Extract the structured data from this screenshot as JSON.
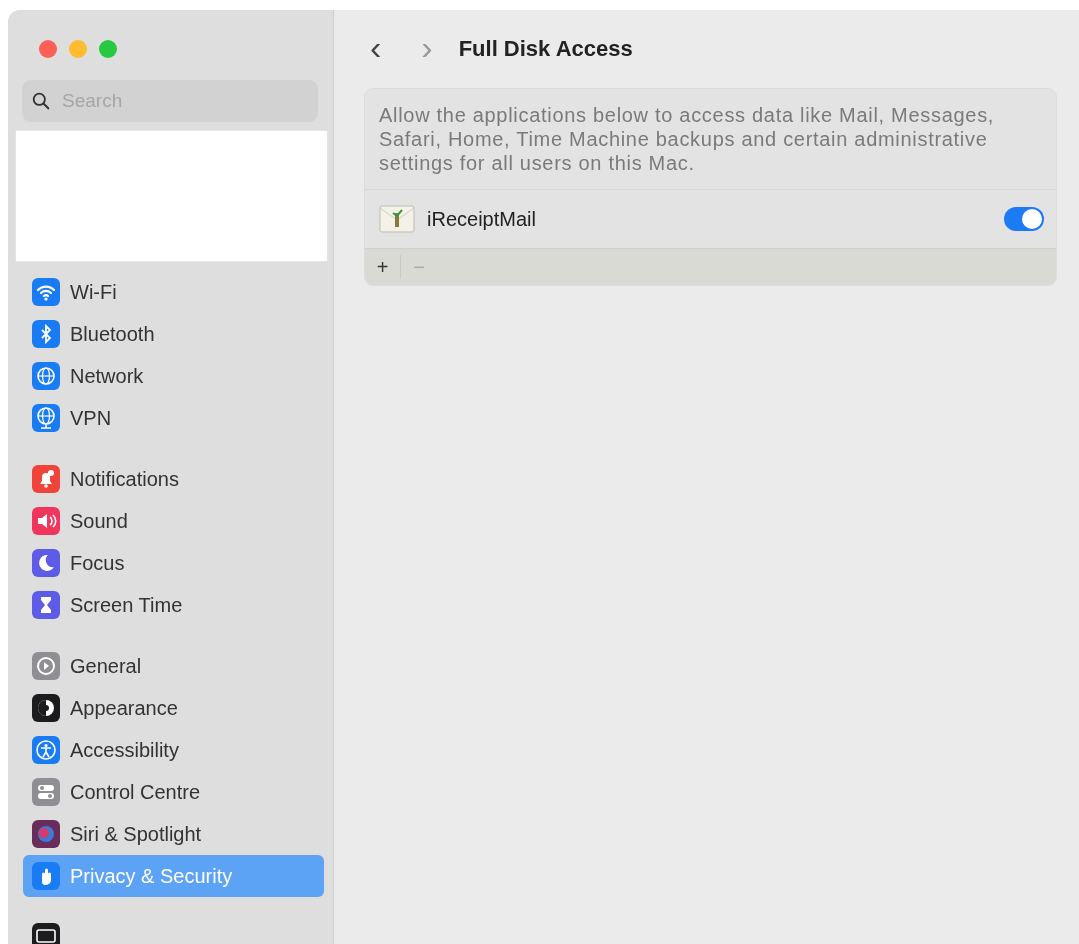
{
  "window": {
    "title": "Full Disk Access",
    "back": "‹",
    "forward": "›"
  },
  "sidebar": {
    "search": {
      "placeholder": "Search"
    },
    "groups": [
      {
        "items": [
          {
            "label": "Wi-Fi",
            "kind": "wifi",
            "color": "#1a7cf5",
            "selected": false
          },
          {
            "label": "Bluetooth",
            "kind": "bluetooth",
            "color": "#1a7cf5",
            "selected": false
          },
          {
            "label": "Network",
            "kind": "globe",
            "color": "#1a7cf5",
            "selected": false
          },
          {
            "label": "VPN",
            "kind": "vpn",
            "color": "#1a7cf5",
            "selected": false
          }
        ]
      },
      {
        "items": [
          {
            "label": "Notifications",
            "kind": "bell",
            "color": "#f0443a",
            "selected": false
          },
          {
            "label": "Sound",
            "kind": "speaker",
            "color": "#f0365c",
            "selected": false
          },
          {
            "label": "Focus",
            "kind": "moon",
            "color": "#5e5ce6",
            "selected": false
          },
          {
            "label": "Screen Time",
            "kind": "hourglass",
            "color": "#5e5ce6",
            "selected": false
          }
        ]
      },
      {
        "items": [
          {
            "label": "General",
            "kind": "gear",
            "color": "#8e8e93",
            "selected": false
          },
          {
            "label": "Appearance",
            "kind": "appearance",
            "color": "#1c1c1e",
            "selected": false
          },
          {
            "label": "Accessibility",
            "kind": "person",
            "color": "#1a7cf5",
            "selected": false
          },
          {
            "label": "Control Centre",
            "kind": "toggles",
            "color": "#8e8e93",
            "selected": false
          },
          {
            "label": "Siri & Spotlight",
            "kind": "siri",
            "color": "#6a2c5a",
            "selected": false
          },
          {
            "label": "Privacy & Security",
            "kind": "hand",
            "color": "#1a7cf5",
            "selected": true
          }
        ]
      },
      {
        "items": [
          {
            "kind": "display",
            "color": "#1c1c1e",
            "selected": false
          }
        ]
      }
    ]
  },
  "panel": {
    "description": "Allow the applications below to access data like Mail, Messages, Safari, Home, Time Machine backups and certain administrative settings for all users on this Mac.",
    "apps": [
      {
        "name": "iReceiptMail",
        "on": true
      }
    ],
    "footer": {
      "add": "+",
      "remove": "−"
    }
  }
}
